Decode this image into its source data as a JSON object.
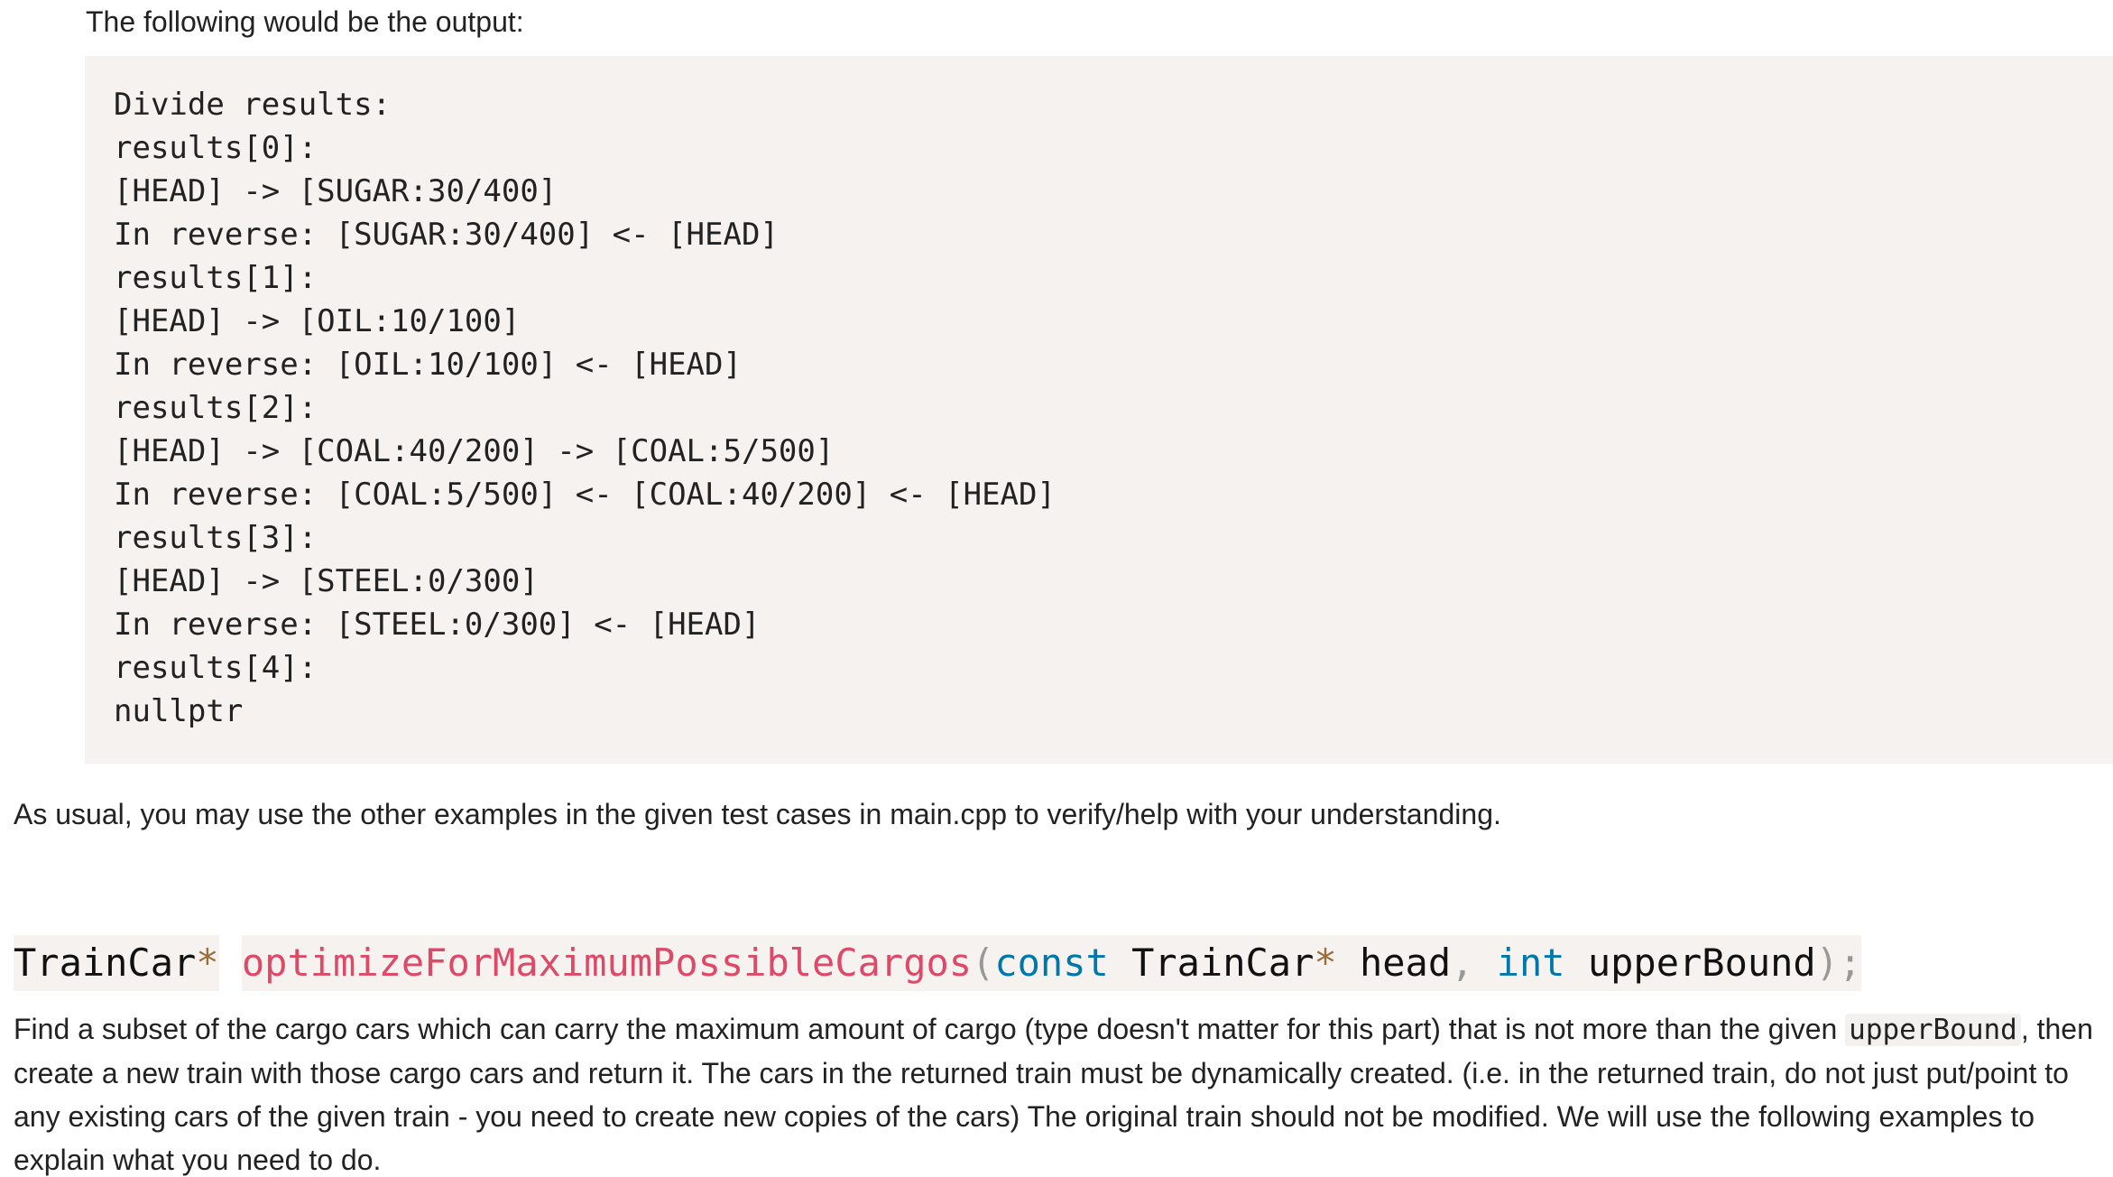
{
  "intro_text": "The following would be the output:",
  "code_lines": [
    "Divide results:",
    "results[0]:",
    "[HEAD] -> [SUGAR:30/400]",
    "In reverse: [SUGAR:30/400] <- [HEAD]",
    "results[1]:",
    "[HEAD] -> [OIL:10/100]",
    "In reverse: [OIL:10/100] <- [HEAD]",
    "results[2]:",
    "[HEAD] -> [COAL:40/200] -> [COAL:5/500]",
    "In reverse: [COAL:5/500] <- [COAL:40/200] <- [HEAD]",
    "results[3]:",
    "[HEAD] -> [STEEL:0/300]",
    "In reverse: [STEEL:0/300] <- [HEAD]",
    "results[4]:",
    "nullptr"
  ],
  "usual_text": "As usual, you may use the other examples in the given test cases in main.cpp to verify/help with your understanding.",
  "signature": {
    "return_type": "TrainCar",
    "star1": "*",
    "space1": " ",
    "function_name": "optimizeForMaximumPossibleCargos",
    "open_paren": "(",
    "const_kw": "const",
    "space2": " ",
    "param1_type": "TrainCar",
    "star2": "*",
    "param1_name": " head",
    "comma": ",",
    "space3": " ",
    "int_kw": "int",
    "param2_name": " upperBound",
    "close_paren": ")",
    "semicolon": ";"
  },
  "description": {
    "part1": "Find a subset of the cargo cars which can carry the maximum amount of cargo (type doesn't matter for this part) that is not more than the given ",
    "inline_code": "upperBound",
    "part2": ", then create a new train with those cargo cars and return it. The cars in the returned train must be dynamically created. (i.e. in the returned train, do not just put/point to any existing cars of the given train - you need to create new copies of the cars) The original train should not be modified. We will use the following examples to explain what you need to do."
  }
}
